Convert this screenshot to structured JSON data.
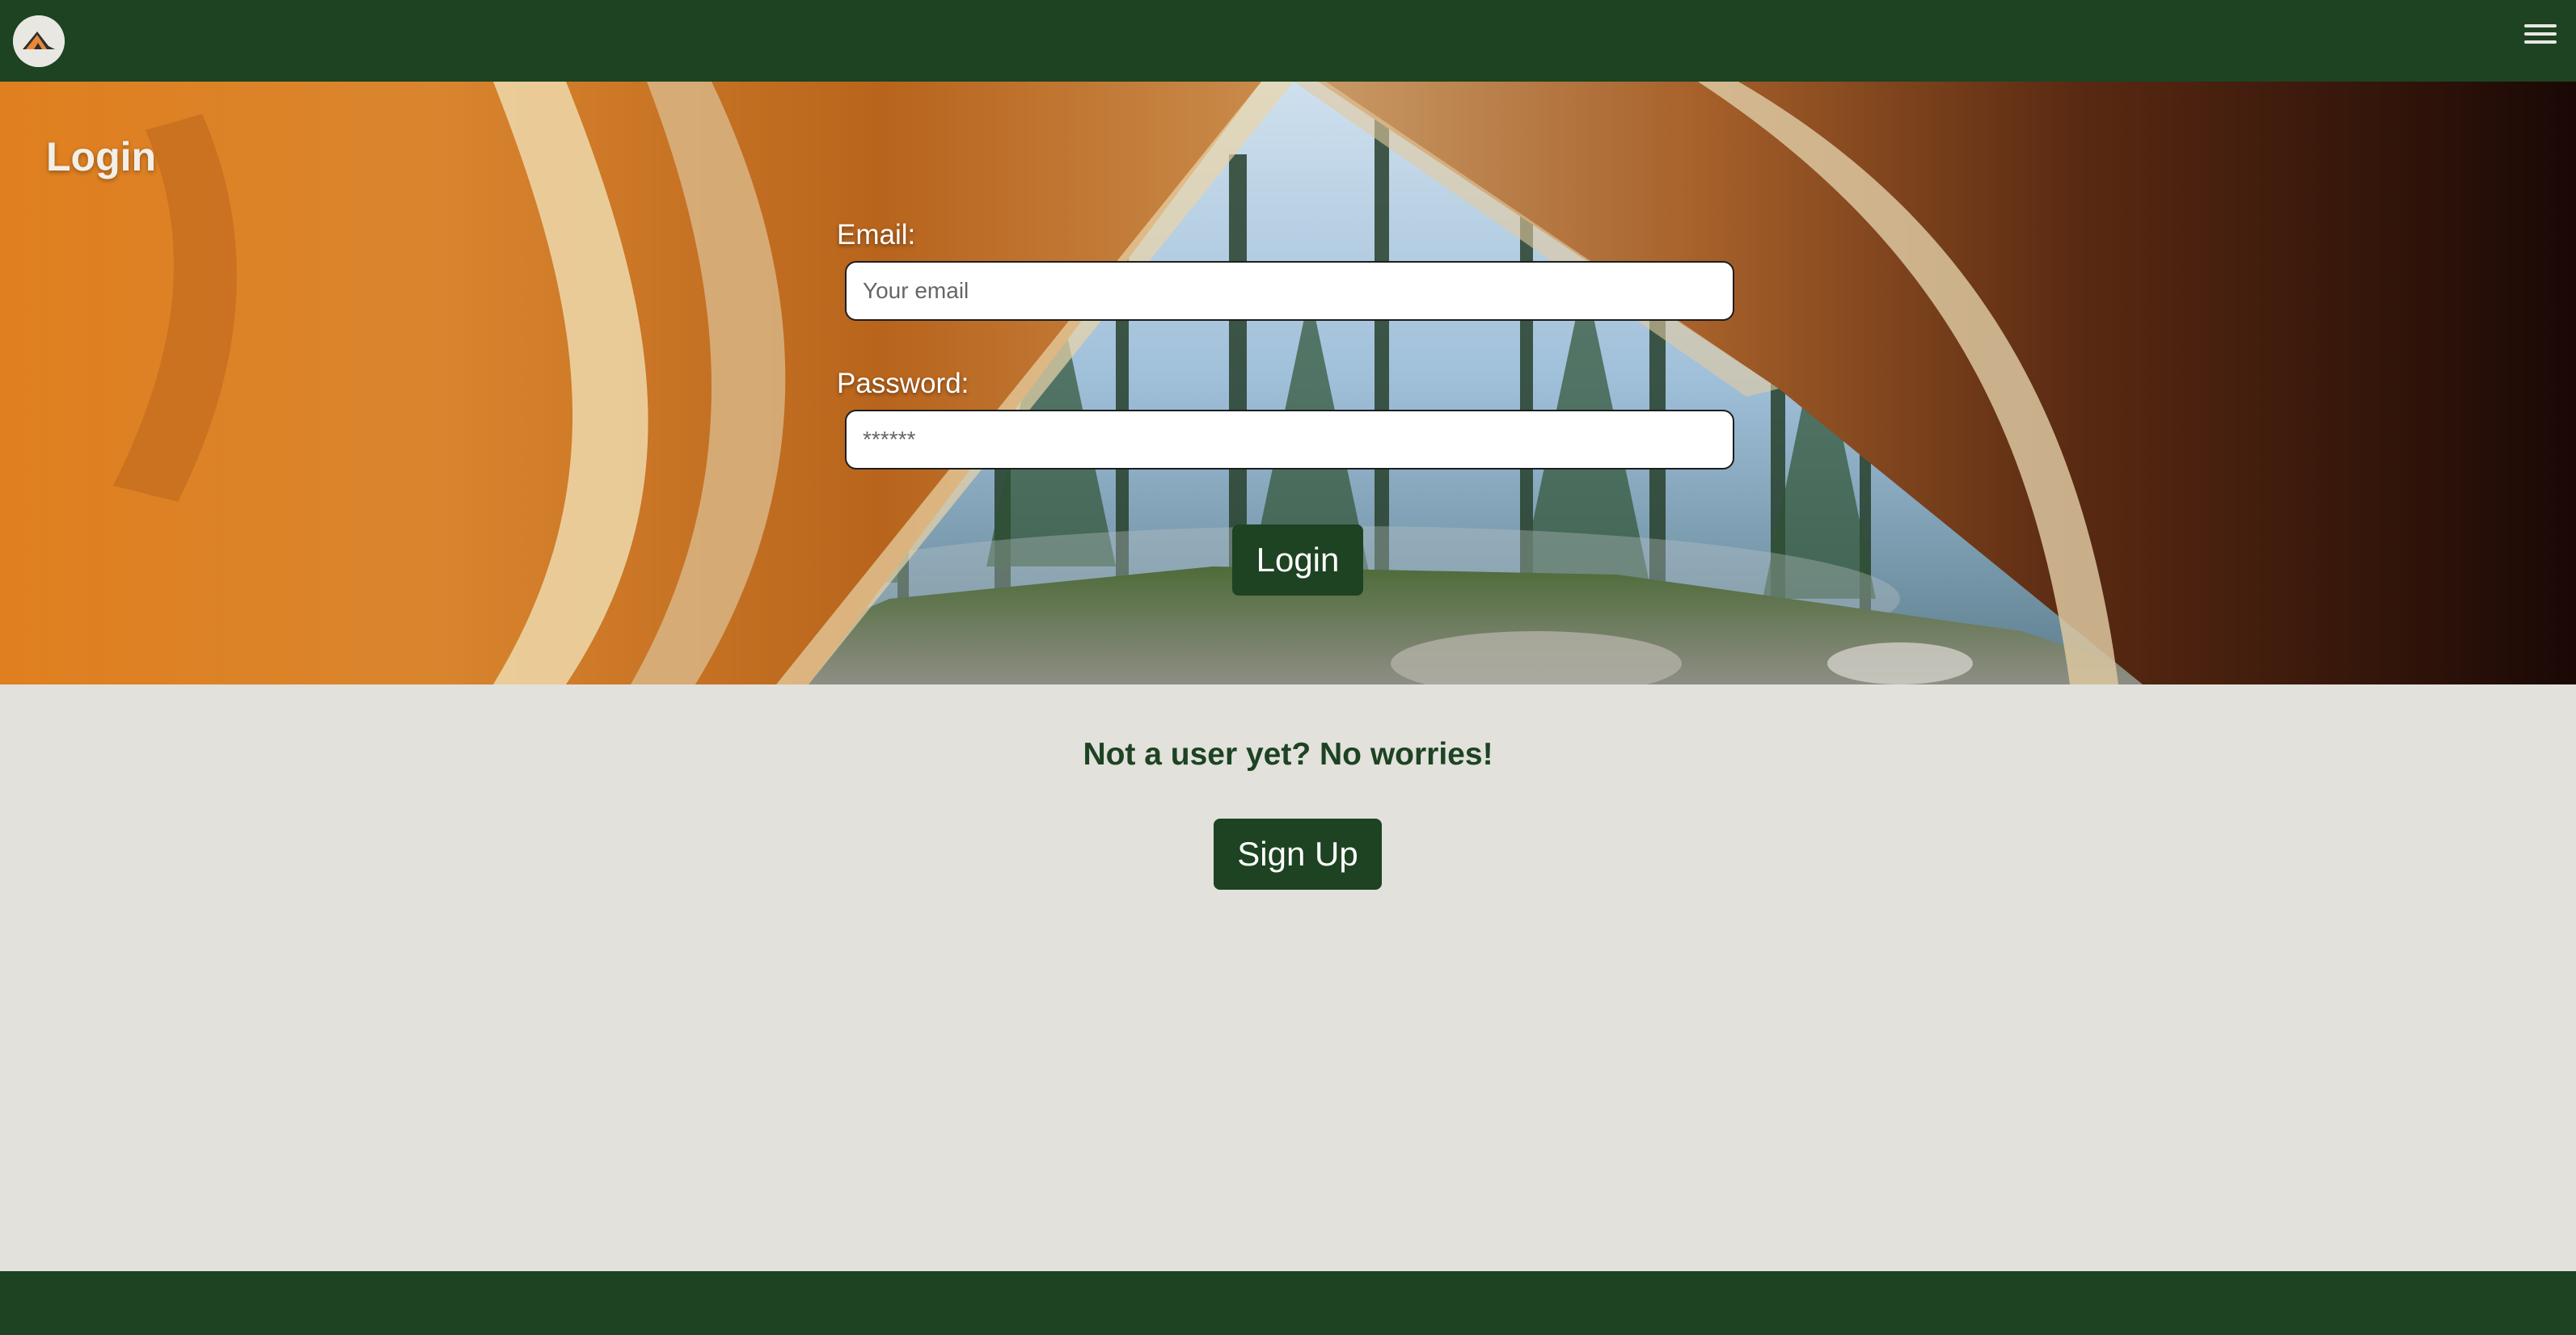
{
  "header": {
    "logo_icon": "tent-logo-icon",
    "menu_icon": "hamburger-menu-icon"
  },
  "hero": {
    "title": "Login",
    "background": "camping-tent-forest-view"
  },
  "form": {
    "email_label": "Email:",
    "email_placeholder": "Your email",
    "email_value": "",
    "password_label": "Password:",
    "password_placeholder": "******",
    "password_value": "",
    "login_label": "Login"
  },
  "signup": {
    "prompt": "Not a user yet? No worries!",
    "button_label": "Sign Up"
  },
  "colors": {
    "brand_green": "#1d4322",
    "page_background": "#e2e1dc",
    "logo_orange": "#e8893a"
  }
}
